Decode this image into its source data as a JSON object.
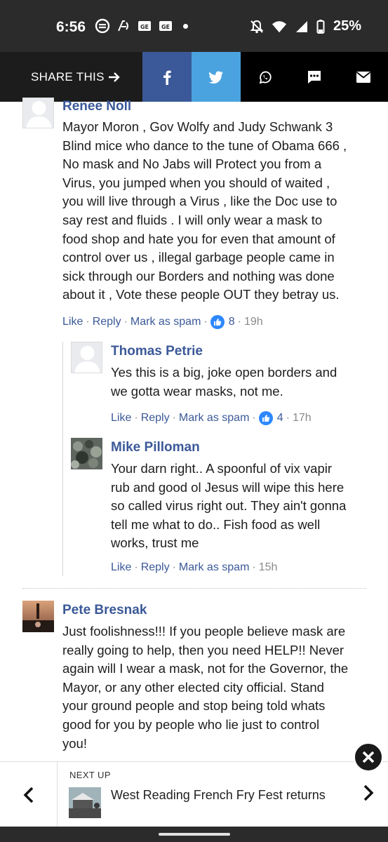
{
  "status_bar": {
    "time": "6:56",
    "battery": "25%",
    "icons": [
      "soup-icon",
      "voice-icon",
      "news-icon",
      "news-icon",
      "dot-icon",
      "mute-icon",
      "wifi-icon",
      "signal-icon",
      "battery-icon"
    ]
  },
  "share_bar": {
    "label": "SHARE THIS",
    "buttons": [
      "facebook-icon",
      "twitter-icon",
      "whatsapp-icon",
      "sms-icon",
      "email-icon"
    ],
    "colors": {
      "facebook": "#3b5998",
      "twitter": "#4aa3df"
    }
  },
  "comments": [
    {
      "author": "Renee Noll",
      "lines": [
        "Mayor Moron , Gov Wolfy and Judy Schwank 3",
        "Blind mice who dance to the tune of Obama 666 ,",
        "No mask and No Jabs will Protect you from a",
        "Virus, you jumped when you should of waited ,",
        "you will live through a Virus , like the Doc use to",
        "say rest and fluids . I will only wear a mask to",
        "food shop and hate you for even that amount of",
        "control over us , illegal garbage people came in",
        "sick through our Borders and nothing was done",
        "about it , Vote these people OUT they betray us."
      ],
      "like": "Like",
      "reply": "Reply",
      "spam": "Mark as spam",
      "likes": "8",
      "time": "19h"
    },
    {
      "author": "Thomas Petrie",
      "lines": [
        "Yes this is a big, joke open borders and",
        "we gotta wear masks, not me."
      ],
      "like": "Like",
      "reply": "Reply",
      "spam": "Mark as spam",
      "likes": "4",
      "time": "17h"
    },
    {
      "author": "Mike Pilloman",
      "lines": [
        "Your darn right.. A spoonful of vix vapir",
        "rub and good ol Jesus will wipe this here",
        "so called virus right out. They ain't gonna",
        "tell me what to do.. Fish food as well",
        "works, trust me"
      ],
      "like": "Like",
      "reply": "Reply",
      "spam": "Mark as spam",
      "time": "15h"
    },
    {
      "author": "Pete Bresnak",
      "lines": [
        "Just foolishness!!! If you people believe mask are",
        "really going to help, then you need HELP!! Never",
        "again will I wear a mask, not for the Governor, the",
        "Mayor, or any other elected city official. Stand",
        "your ground people and stop being told whats",
        "good for you by people who lie just to control",
        "you!"
      ]
    }
  ],
  "next_up": {
    "label": "NEXT UP",
    "title": "West Reading French Fry Fest returns"
  }
}
